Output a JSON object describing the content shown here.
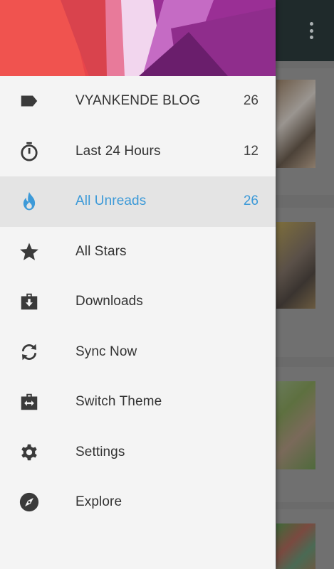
{
  "colors": {
    "accent": "#3d9ad8",
    "drawer_bg": "#f4f4f4",
    "active_bg": "#e4e4e4",
    "toolbar_bg": "#1f2a2b",
    "icon": "#3a3a3a"
  },
  "toolbar": {
    "overflow_icon": "more-vertical-icon"
  },
  "drawer": {
    "items": [
      {
        "label": "VYANKENDE BLOG",
        "count": "26",
        "icon": "label-icon",
        "active": false
      },
      {
        "label": "Last 24 Hours",
        "count": "12",
        "icon": "timer-icon",
        "active": false
      },
      {
        "label": "All Unreads",
        "count": "26",
        "icon": "flame-icon",
        "active": true
      },
      {
        "label": "All Stars",
        "count": "",
        "icon": "star-icon",
        "active": false
      },
      {
        "label": "Downloads",
        "count": "",
        "icon": "download-box-icon",
        "active": false
      },
      {
        "label": "Sync Now",
        "count": "",
        "icon": "sync-icon",
        "active": false
      },
      {
        "label": "Switch Theme",
        "count": "",
        "icon": "switch-theme-icon",
        "active": false
      },
      {
        "label": "Settings",
        "count": "",
        "icon": "gear-icon",
        "active": false
      },
      {
        "label": "Explore",
        "count": "",
        "icon": "compass-icon",
        "active": false
      }
    ]
  }
}
